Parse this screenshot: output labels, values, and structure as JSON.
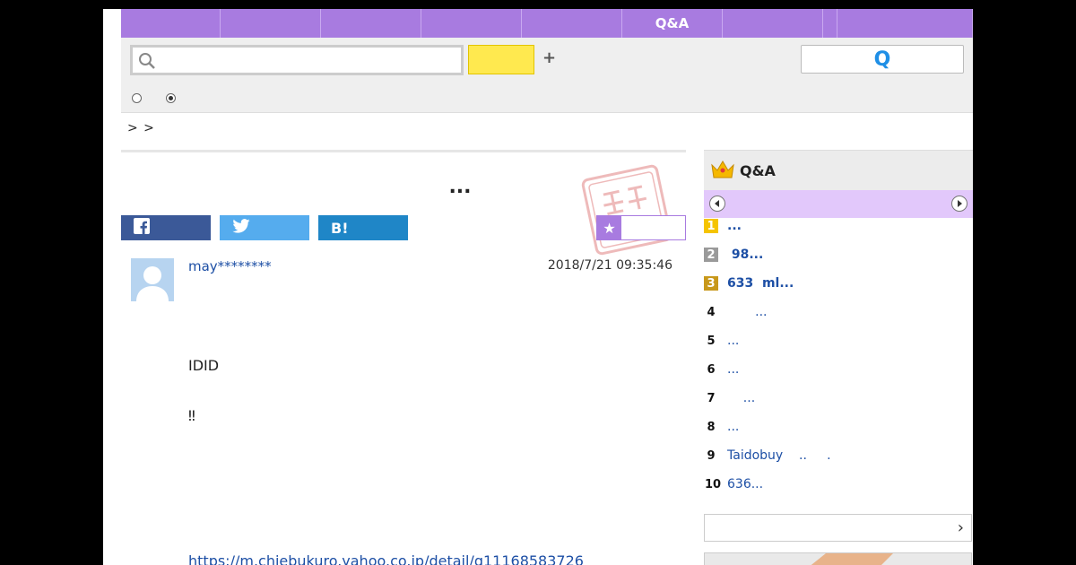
{
  "nav": {
    "tabs": [
      {
        "label": "",
        "width": 111
      },
      {
        "label": "",
        "width": 112
      },
      {
        "label": "",
        "width": 112
      },
      {
        "label": "",
        "width": 112
      },
      {
        "label": "",
        "width": 112
      },
      {
        "label": "Q&A",
        "width": 112
      },
      {
        "label": "",
        "width": 112
      },
      {
        "label": "",
        "width": 16
      },
      {
        "label": "",
        "width": 151
      }
    ]
  },
  "search": {
    "placeholder": "",
    "button_label": "",
    "plus_label": "+",
    "q_label": "Q"
  },
  "breadcrumb": ">  >",
  "question": {
    "title": "...",
    "user": "may********",
    "date": "2018/7/21  09:35:46",
    "lines": [
      "IDID",
      "‼"
    ],
    "link": "https://m.chiebukuro.yahoo.co.jp/detail/q11168583726"
  },
  "share": {
    "facebook_color": "#3b5998",
    "twitter_color": "#55acee",
    "hatena_color": "#1f86c7",
    "hatena_label": "B!"
  },
  "ranking": {
    "title": "Q&A",
    "items": [
      {
        "num": "1",
        "text": "...",
        "bold": true,
        "badge": "#f5c400"
      },
      {
        "num": "2",
        "text": " 98...",
        "bold": true,
        "badge": "#9a9a9a"
      },
      {
        "num": "3",
        "text": "633  ml...",
        "bold": true,
        "badge": "#c8981a"
      },
      {
        "num": "4",
        "text": "       ...",
        "bold": false,
        "badge": ""
      },
      {
        "num": "5",
        "text": "...",
        "bold": false,
        "badge": ""
      },
      {
        "num": "6",
        "text": "...",
        "bold": false,
        "badge": ""
      },
      {
        "num": "7",
        "text": "    ...",
        "bold": false,
        "badge": ""
      },
      {
        "num": "8",
        "text": "...",
        "bold": false,
        "badge": ""
      },
      {
        "num": "9",
        "text": "Taidobuy    ..     .",
        "bold": false,
        "badge": ""
      },
      {
        "num": "10",
        "text": "636...",
        "bold": false,
        "badge": ""
      }
    ]
  },
  "colors": {
    "accent": "#a87be0",
    "link": "#1d4fa5",
    "search_button": "#ffe94f"
  }
}
